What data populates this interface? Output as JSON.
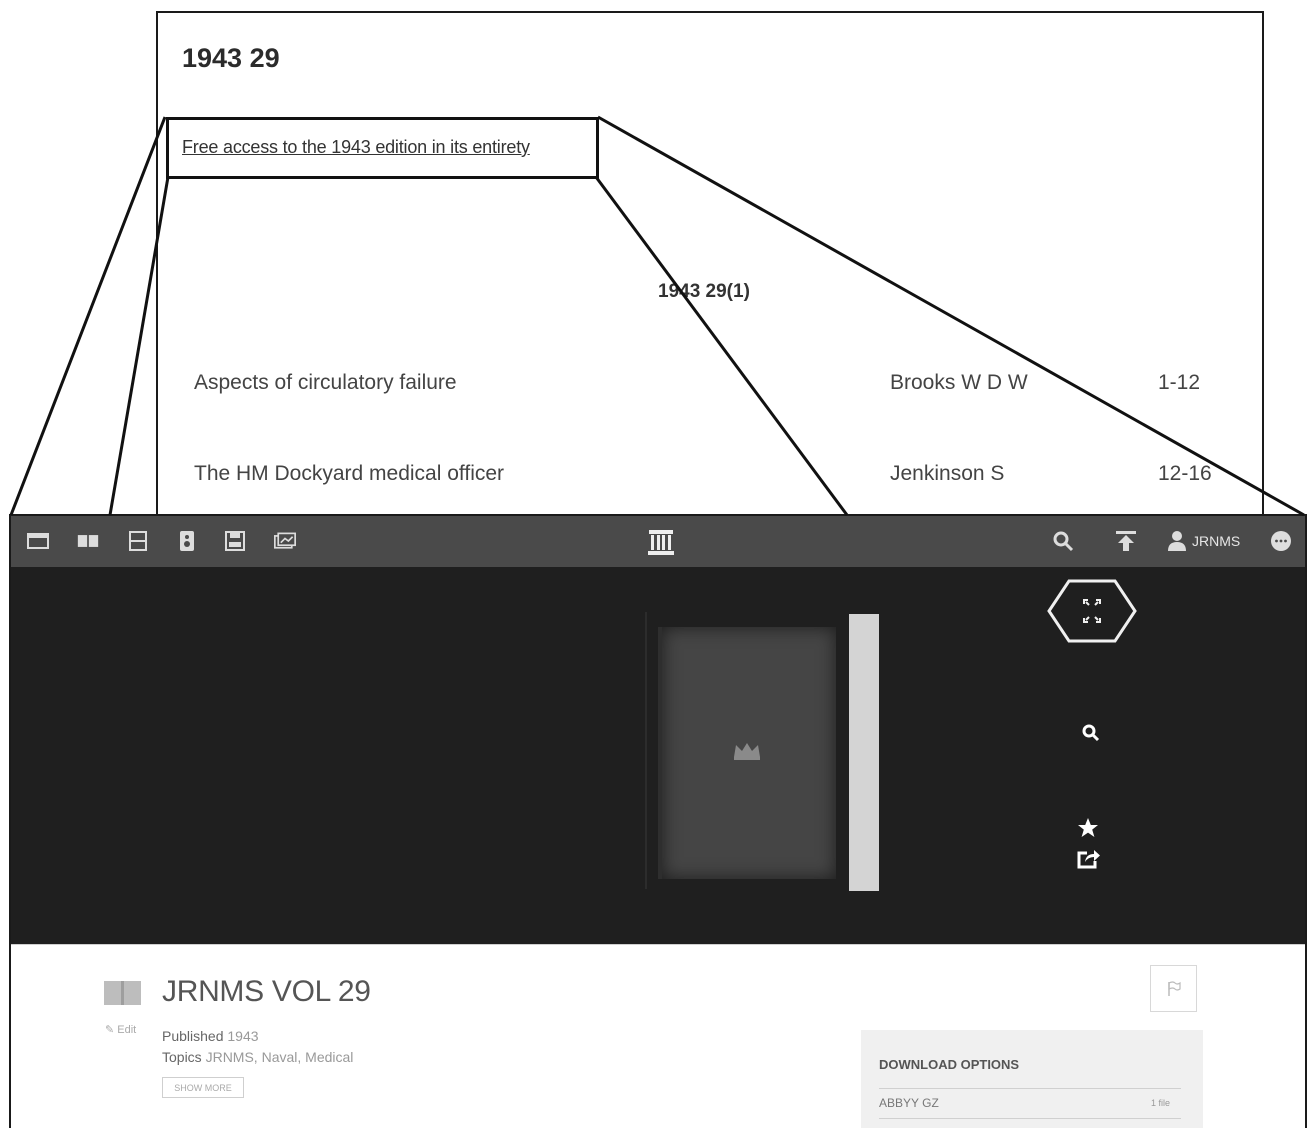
{
  "document": {
    "title": "1943 29",
    "free_access_link": "Free access to the 1943 edition in its entirety",
    "issue_heading": "1943 29(1)",
    "articles": [
      {
        "title": "Aspects of circulatory failure",
        "author": "Brooks W D W",
        "pages": "1-12"
      },
      {
        "title": "The HM Dockyard medical officer",
        "author": "Jenkinson S",
        "pages": "12-16"
      }
    ]
  },
  "toolbar": {
    "left_icons": [
      "single-page-icon",
      "two-page-icon",
      "vertical-scroll-icon",
      "speaker-icon",
      "save-icon",
      "image-gallery-icon"
    ],
    "center_icon": "archive-building-icon",
    "right_icons": [
      "search-icon",
      "upload-icon",
      "user-icon",
      "more-icon"
    ],
    "user_name": "JRNMS"
  },
  "viewer": {
    "controls": [
      "fullscreen-icon",
      "zoom-icon",
      "favorite-star-icon",
      "share-icon"
    ]
  },
  "item": {
    "title": "JRNMS VOL 29",
    "edit_label": "Edit",
    "published_label": "Published",
    "published_value": "1943",
    "topics_label": "Topics",
    "topics_value": "JRNMS, Naval, Medical",
    "show_more_label": "SHOW MORE"
  },
  "downloads": {
    "title": "DOWNLOAD OPTIONS",
    "items": [
      {
        "name": "ABBYY GZ",
        "count": "1 file"
      }
    ]
  },
  "colors": {
    "toolbar_bg": "#4a4a4a",
    "viewer_bg": "#1f1f1f",
    "download_panel_bg": "#f0f0f0"
  }
}
